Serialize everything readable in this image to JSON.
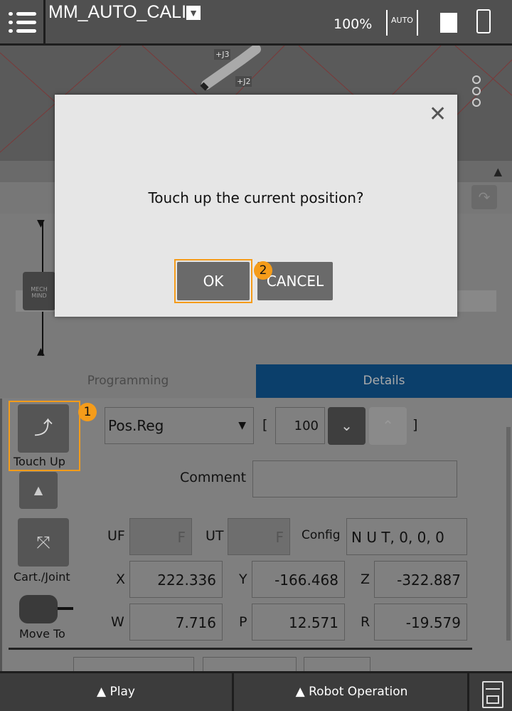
{
  "header": {
    "title": "MM_AUTO_CALI",
    "speed": "100%",
    "icons": [
      "menu-icon",
      "auto-mode-icon",
      "teach-pendant-icon",
      "touch-screen-icon"
    ]
  },
  "viewport": {
    "joint_labels": [
      "+J3",
      "+J2"
    ]
  },
  "tabs": [
    {
      "label": "Programming",
      "active": false
    },
    {
      "label": "Details",
      "active": true
    }
  ],
  "details": {
    "touch_up_label": "Touch Up",
    "touch_up_badge": "1",
    "register_type": "Pos.Reg",
    "open_bracket": "[",
    "register_index": "100",
    "close_bracket": "]",
    "comment_label": "Comment",
    "comment_value": "",
    "cart_joint_label": "Cart./Joint",
    "move_to_label": "Move To",
    "uf_label": "UF",
    "uf_value": "F",
    "ut_label": "UT",
    "ut_value": "F",
    "config_label": "Config",
    "config_value": "N U T, 0, 0, 0",
    "x_label": "X",
    "x": "222.336",
    "y_label": "Y",
    "y": "-166.468",
    "z_label": "Z",
    "z": "-322.887",
    "w_label": "W",
    "w": "7.716",
    "p_label": "P",
    "p": "12.571",
    "r_label": "R",
    "r": "-19.579"
  },
  "dialog": {
    "message": "Touch up the current position?",
    "ok": "OK",
    "cancel": "CANCEL",
    "ok_badge": "2",
    "highlight_color": "#f59c1a"
  },
  "bottom": {
    "play": "▲ Play",
    "robot_operation": "▲ Robot Operation"
  }
}
